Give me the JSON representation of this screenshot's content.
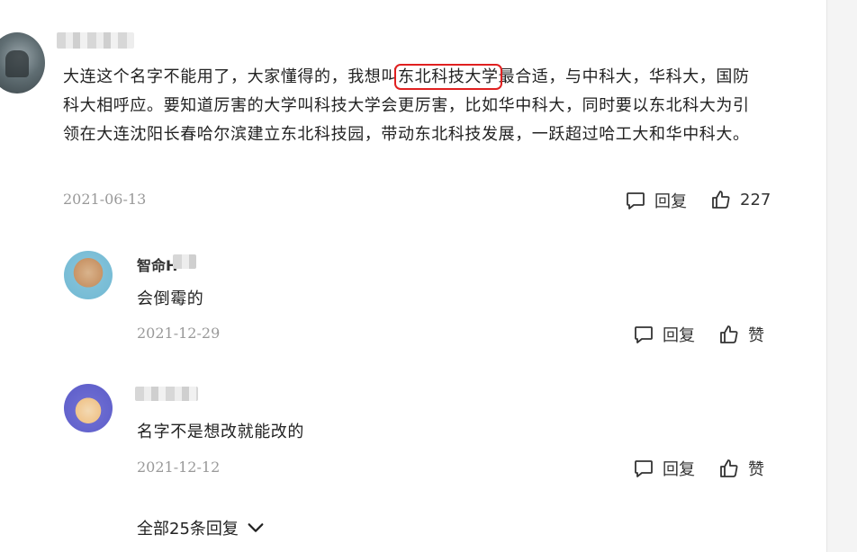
{
  "main_comment": {
    "text_before": "大连这个名字不能用了，大家懂得的，我想叫",
    "highlight": "东北科技大学",
    "text_after": "最合适，与中科大，华科大，国防科大相呼应。要知道厉害的大学叫科技大学会更厉害，比如华中科大，同时要以东北科大为引领在大连沈阳长春哈尔滨建立东北科技园，带动东北科技发展，一跃超过哈工大和华中科大。",
    "date": "2021-06-13",
    "reply_label": "回复",
    "like_count": "227"
  },
  "replies": [
    {
      "name": "智命H",
      "text": "会倒霉的",
      "date": "2021-12-29",
      "reply_label": "回复",
      "like_label": "赞"
    },
    {
      "text": "名字不是想改就能改的",
      "date": "2021-12-12",
      "reply_label": "回复",
      "like_label": "赞"
    }
  ],
  "show_all_replies": "全部25条回复",
  "icons": {
    "reply": "speech-bubble-icon",
    "like": "thumbs-up-icon",
    "expand": "chevron-down-icon"
  },
  "colors": {
    "highlight_border": "#e02020",
    "date_text": "#999999"
  }
}
